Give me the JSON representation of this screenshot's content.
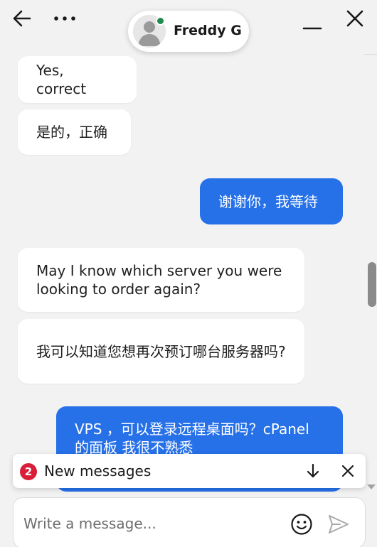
{
  "header": {
    "agent_name": "Freddy G",
    "presence_color": "#1f8a4c",
    "icons": {
      "back": "arrow-left-icon",
      "more": "more-horizontal-icon",
      "minimize": "minus-icon",
      "close": "close-icon"
    }
  },
  "messages": [
    {
      "from": "agent",
      "text": "Yes, correct"
    },
    {
      "from": "agent",
      "text": "是的，正确"
    },
    {
      "from": "user",
      "text": "谢谢你，我等待"
    },
    {
      "from": "agent",
      "text": "May I know which server you were looking to order again?"
    },
    {
      "from": "agent",
      "text": "我可以知道您想再次预订哪台服务器吗?"
    },
    {
      "from": "user",
      "text": "VPS ，可以登录远程桌面吗？cPanel 的面板 我很不熟悉"
    }
  ],
  "new_messages": {
    "count": "2",
    "label": "New messages",
    "badge_color": "#d91e3a"
  },
  "composer": {
    "placeholder": "Write a message...",
    "icons": {
      "emoji": "smiley-icon",
      "send": "send-icon"
    }
  },
  "colors": {
    "accent": "#2670e8",
    "background": "#f2f2f3"
  }
}
